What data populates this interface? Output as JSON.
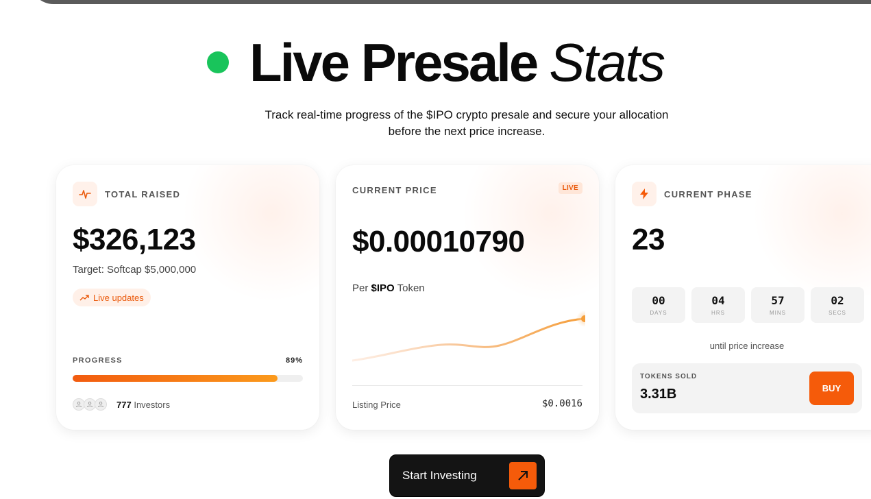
{
  "headline": {
    "title": "Live Presale",
    "title_italic": "Stats",
    "subtitle": "Track real-time progress of the $IPO crypto presale and secure your allocation before the next price increase."
  },
  "cards": {
    "total_raised": {
      "label": "TOTAL RAISED",
      "value": "$326,123",
      "target": "Target: Softcap $5,000,000",
      "live_updates": "Live updates",
      "progress_label": "PROGRESS",
      "progress_percent": "89%",
      "progress_fraction": 0.89,
      "investors_count": "777",
      "investors_label": "Investors"
    },
    "current_price": {
      "label": "CURRENT PRICE",
      "badge": "LIVE",
      "value": "$0.00010790",
      "per_prefix": "Per",
      "token": "$IPO",
      "per_suffix": "Token",
      "listing_label": "Listing Price",
      "listing_value": "$0.0016"
    },
    "current_phase": {
      "label": "CURRENT PHASE",
      "value": "23",
      "countdown": [
        {
          "value": "00",
          "unit": "DAYS"
        },
        {
          "value": "04",
          "unit": "HRS"
        },
        {
          "value": "57",
          "unit": "MINS"
        },
        {
          "value": "02",
          "unit": "SECS"
        }
      ],
      "until_text": "until price increase",
      "tokens_sold_label": "TOKENS SOLD",
      "tokens_sold_value": "3.31B",
      "buy_label": "BUY"
    }
  },
  "cta": {
    "label": "Start Investing"
  },
  "colors": {
    "accent": "#f55b0a",
    "live_dot": "#19c45b",
    "dark": "#141414"
  }
}
